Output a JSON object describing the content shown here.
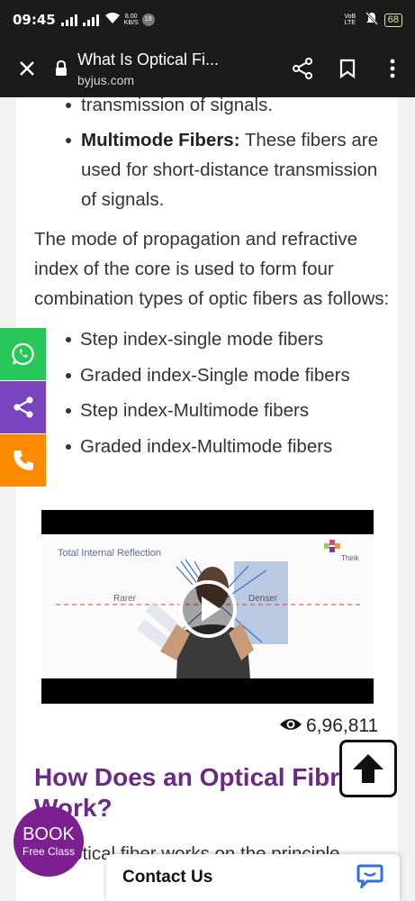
{
  "status_bar": {
    "time": "09:45",
    "net_speed_value": "8.00",
    "net_speed_unit": "KB/S",
    "notif_count": "19",
    "volte": "VoB LTE",
    "battery": "68"
  },
  "browser": {
    "page_title": "What Is Optical Fi...",
    "url": "byjus.com"
  },
  "article": {
    "prev_item_tail": "transmission of signals.",
    "multimode_term": "Multimode Fibers:",
    "multimode_desc": " These fibers are used for short-distance transmission of signals.",
    "paragraph": "The mode of propagation and refractive index of the core is used to form four combination types of optic fibers as follows:",
    "fiber_types": [
      "Step index-single mode fibers",
      "Graded index-Single mode fibers",
      "Step index-Multimode fibers",
      "Graded index-Multimode fibers"
    ],
    "video": {
      "label_title": "Total Internal Reflection",
      "label_rarer": "Rarer",
      "label_denser": "Denser",
      "brand": "Think"
    },
    "views": "6,96,811",
    "section_heading": "How Does an Optical Fibre Work?",
    "body_text": "An optical fiber works on the principle"
  },
  "floating": {
    "book_title": "BOOK",
    "book_sub": "Free Class",
    "contact_label": "Contact Us"
  },
  "colors": {
    "heading": "#6b2a86",
    "whatsapp": "#27c75a",
    "share": "#7a43c0",
    "call": "#ff8a00",
    "book": "#7d1f91",
    "chat_icon": "#2f6fe0"
  }
}
